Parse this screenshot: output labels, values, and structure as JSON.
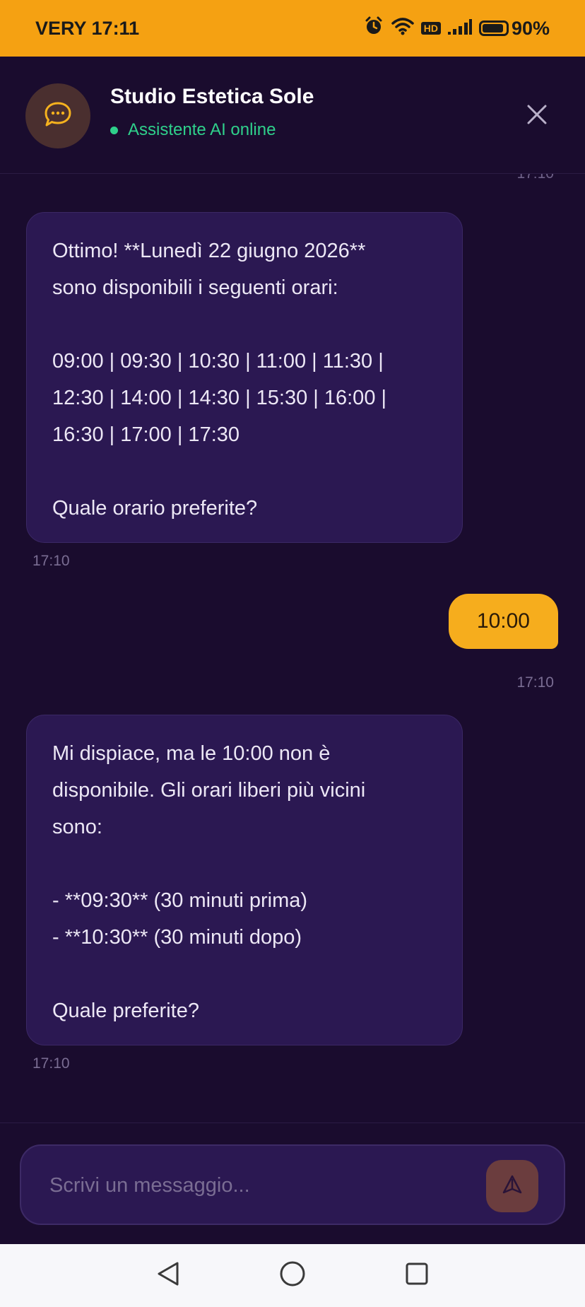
{
  "status_bar": {
    "carrier_time": "VERY 17:11",
    "hd_label": "HD",
    "battery_percent": "90%",
    "battery_level": 0.9,
    "icons": [
      "alarm-icon",
      "wifi-icon",
      "hd-icon",
      "signal-icon",
      "battery-icon"
    ]
  },
  "header": {
    "title": "Studio Estetica Sole",
    "status": "Assistente AI online",
    "avatar_icon": "chat-bubble-icon",
    "close_icon": "close-icon"
  },
  "messages": {
    "partial_timestamp": "17:10",
    "items": [
      {
        "sender": "assistant",
        "text": "Ottimo! **Lunedì 22 giugno 2026**\nsono disponibili i seguenti orari:\n\n09:00 | 09:30 | 10:30 | 11:00 | 11:30 |\n12:30 | 14:00 | 14:30 | 15:30 | 16:00 |\n16:30 | 17:00 | 17:30\n\nQuale orario preferite?",
        "time": "17:10"
      },
      {
        "sender": "user",
        "text": "10:00",
        "time": "17:10"
      },
      {
        "sender": "assistant",
        "text": "Mi dispiace, ma le 10:00 non è\ndisponibile. Gli orari liberi più vicini\nsono:\n\n- **09:30** (30 minuti prima)\n- **10:30** (30 minuti dopo)\n\nQuale preferite?",
        "time": "17:10"
      }
    ]
  },
  "composer": {
    "placeholder": "Scrivi un messaggio...",
    "value": "",
    "send_icon": "send-icon"
  },
  "nav_bar": {
    "icons": [
      "back-icon",
      "home-icon",
      "recents-icon"
    ]
  },
  "colors": {
    "status_bar": "#f5a112",
    "background": "#1a0c2e",
    "bot_bubble": "#2b1852",
    "user_bubble": "#f6ad1d",
    "online": "#2fd08b"
  }
}
